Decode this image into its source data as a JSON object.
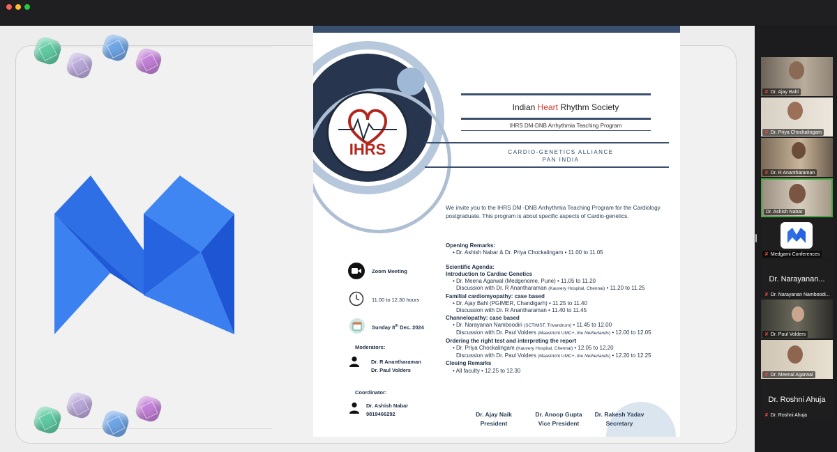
{
  "window": {
    "traffic_lights": {
      "close": "#fe5f57",
      "minimize": "#febc2e",
      "zoom": "#28c840"
    }
  },
  "brand": {
    "accent": "#2f6ee8",
    "heart_red": "#d0392b"
  },
  "document": {
    "logo_text": "IHRS",
    "org_title_pre": "Indian ",
    "org_title_heart": "Heart",
    "org_title_post": " Rhythm Society",
    "program_title": "IHRS DM-DNB Arrhythmia Teaching Program",
    "alliance_line1": "CARDIO-GENETICS ALLIANCE",
    "alliance_line2": "PAN INDIA",
    "intro": "We invite you to the IHRS DM -DNB Arrhythmia Teaching Program for the Cardiology postgraduate. This program is about specific aspects of Cardio-genetics.",
    "meeting": {
      "platform": "Zoom Meeting",
      "time": "11.00 to 12.30 hours",
      "date_pre": "Sunday 8",
      "date_sup": "th",
      "date_post": " Dec. 2024"
    },
    "moderators_label": "Moderators:",
    "moderators": [
      "Dr. R Anantharaman",
      "Dr. Paul Volders"
    ],
    "coordinator_label": "Coordinator:",
    "coordinator_name": "Dr. Ashish Nabar",
    "coordinator_phone": "9819466292",
    "agenda": {
      "opening_heading": "Opening Remarks:",
      "opening_item": "• Dr. Ashish Nabar & Dr. Priya Chockalingam • 11.00 to 11.05",
      "scientific_heading": "Scientific Agenda:",
      "s1_heading": "Introduction to Cardiac Genetics",
      "s1_item": "• Dr. Meena Agarwal (Medgenome, Pune) • 11.05 to 11.20",
      "s1_disc_pre": "Discussion with Dr. R Anantharaman ",
      "s1_disc_sm": "(Kauvery Hospital, Chennai)",
      "s1_disc_post": " • 11.20 to 11.25",
      "s2_heading": "Familial cardiomyopathy: case based",
      "s2_item": "• Dr. Ajay Bahl (PGIMER, Chandigarh) • 11.25 to 11.40",
      "s2_disc": "Discussion with Dr. R Anantharaman • 11.40 to 11.45",
      "s3_heading": "Channelopathy: case based",
      "s3_item_pre": "• Dr. Narayanan Namboodiri ",
      "s3_item_sm": "(SCTIMST, Trivandrum)",
      "s3_item_post": " • 11.45 to 12.00",
      "s3_disc_pre": "Discussion with Dr. Paul Volders ",
      "s3_disc_sm_a": "(Maastricht UMC+, ",
      "s3_disc_sm_i": "the Netherlands",
      "s3_disc_sm_b": ")",
      "s3_disc_post": " • 12.00 to 12.05",
      "s4_heading": "Ordering the right test and interpreting the report",
      "s4_item_pre": "• Dr. Priya Chockalingam ",
      "s4_item_sm": "(Kauvery Hospital, Chennai)",
      "s4_item_post": " • 12.05 to 12.20",
      "s4_disc_pre": "Discussion with Dr. Paul Volders ",
      "s4_disc_sm_a": "(Maastricht UMC+, ",
      "s4_disc_sm_i": "the Netherlands",
      "s4_disc_sm_b": ")",
      "s4_disc_post": " • 12.20 to 12.25",
      "closing_heading": "Closing Remarks",
      "closing_item": "• All faculty • 12.25 to 12.30"
    },
    "signatories": [
      {
        "name": "Dr. Ajay Naik",
        "role": "President"
      },
      {
        "name": "Dr. Anoop Gupta",
        "role": "Vice President"
      },
      {
        "name": "Dr. Rakesh Yadav",
        "role": "Secretary"
      }
    ]
  },
  "participants": [
    {
      "name": "Dr. Ajay Bahl",
      "video": true
    },
    {
      "name": "Dr. Priya Chockalingam",
      "video": true
    },
    {
      "name": "Dr. R Anantharaman",
      "video": true
    },
    {
      "name": "Dr. Ashish Nabar",
      "video": true,
      "active": true
    },
    {
      "name": "Medgami Conferences",
      "video": false,
      "logo": true
    },
    {
      "name": "Dr. Narayanan Namboodiri",
      "display": "Dr. Narayanan...",
      "tag": "Dr. Narayanan Namboodi...",
      "video": false
    },
    {
      "name": "Dr. Paul Volders",
      "video": true
    },
    {
      "name": "Dr. Meenal Agarwal",
      "video": true
    },
    {
      "name": "Dr. Roshni Ahuja",
      "display": "Dr. Roshni Ahuja",
      "video": false
    }
  ]
}
